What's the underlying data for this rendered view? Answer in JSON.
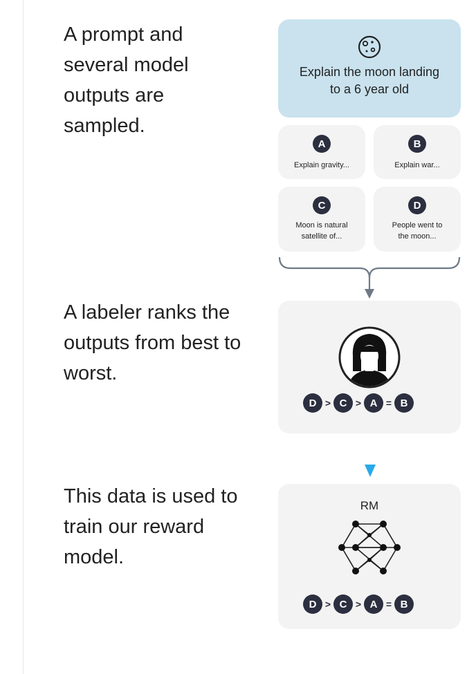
{
  "steps": [
    {
      "text": "A prompt and several model outputs are sampled."
    },
    {
      "text": "A labeler ranks the outputs from best to worst."
    },
    {
      "text": "This data is used to train our reward model."
    }
  ],
  "prompt": {
    "icon": "moon-icon",
    "text": "Explain the moon landing to a 6 year old"
  },
  "outputs": [
    {
      "letter": "A",
      "text": "Explain gravity..."
    },
    {
      "letter": "B",
      "text": "Explain war..."
    },
    {
      "letter": "C",
      "text": "Moon is natural satellite of..."
    },
    {
      "letter": "D",
      "text": "People went to the moon..."
    }
  ],
  "labeler": {
    "icon": "labeler-avatar-icon"
  },
  "ranking": {
    "items": [
      "D",
      "C",
      "A",
      "B"
    ],
    "ops": [
      ">",
      ">",
      "="
    ]
  },
  "reward_model": {
    "label": "RM",
    "icon": "neural-network-icon"
  },
  "colors": {
    "prompt_bg": "#c9e2ee",
    "card_bg": "#f3f3f3",
    "badge": "#2b2f3f",
    "arrow_accent": "#2aa8e8",
    "bracket": "#6f7a86"
  }
}
